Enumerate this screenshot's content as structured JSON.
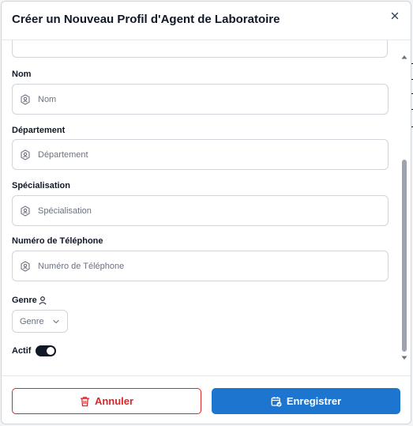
{
  "modal": {
    "title": "Créer un Nouveau Profil d'Agent de Laboratoire",
    "close_icon": "close-icon"
  },
  "form": {
    "fields": [
      {
        "label": "Nom",
        "placeholder": "Nom",
        "value": "",
        "icon": "id-badge-icon"
      },
      {
        "label": "Département",
        "placeholder": "Département",
        "value": "",
        "icon": "id-badge-icon"
      },
      {
        "label": "Spécialisation",
        "placeholder": "Spécialisation",
        "value": "",
        "icon": "id-badge-icon"
      },
      {
        "label": "Numéro de Téléphone",
        "placeholder": "Numéro de Téléphone",
        "value": "",
        "icon": "id-badge-icon"
      }
    ],
    "genre": {
      "label": "Genre",
      "icon": "user-icon",
      "selected": "Genre"
    },
    "actif": {
      "label": "Actif",
      "on": true
    }
  },
  "footer": {
    "cancel_label": "Annuler",
    "cancel_icon": "trash-icon",
    "save_label": "Enregistrer",
    "save_icon": "calendar-check-icon"
  },
  "colors": {
    "primary": "#1d75d0",
    "danger": "#dc2626",
    "border": "#d1d5db",
    "text": "#111827",
    "muted": "#6b7280"
  }
}
